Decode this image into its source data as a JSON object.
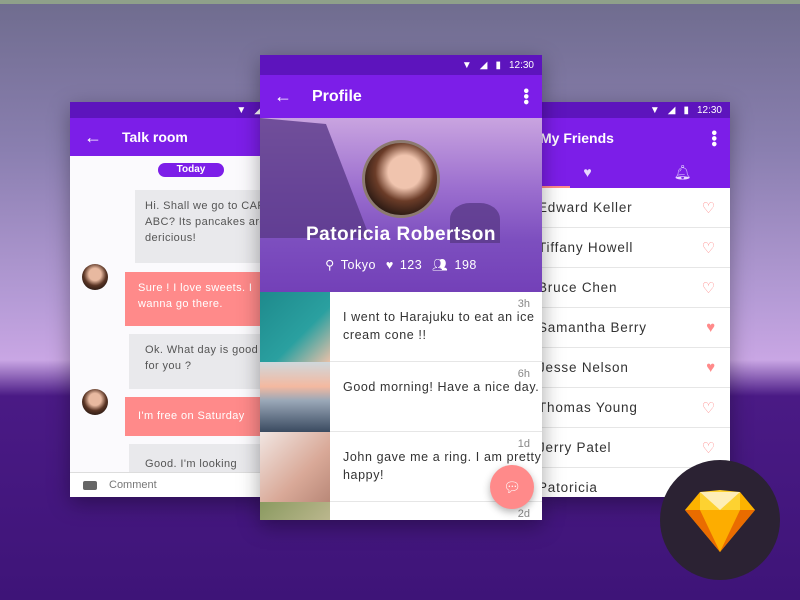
{
  "status": {
    "time": "12:30"
  },
  "talk": {
    "title": "Talk room",
    "date": "Today",
    "messages": [
      {
        "type": "in",
        "text": "Hi. Shall we go to CAFE ABC? Its pancakes are dericious!"
      },
      {
        "type": "out",
        "text": "Sure ! I love sweets. I wanna go there."
      },
      {
        "type": "in",
        "text": "Ok. What day is good for you ?"
      },
      {
        "type": "out",
        "text": "I'm free on Saturday"
      },
      {
        "type": "in",
        "text": "Good. I'm looking"
      }
    ],
    "comment_placeholder": "Comment"
  },
  "profile": {
    "title": "Profile",
    "name": "Patoricia Robertson",
    "location": "Tokyo",
    "likes": "123",
    "friends": "198",
    "posts": [
      {
        "text": "I went to Harajuku to eat an ice cream cone !!",
        "time": "3h"
      },
      {
        "text": "Good morning! Have a nice day.",
        "time": "6h"
      },
      {
        "text": "John gave me a ring. I am pretty happy!",
        "time": "1d"
      },
      {
        "text": "",
        "time": "2d"
      }
    ]
  },
  "friends": {
    "title": "My Friends",
    "tabs": [
      "heart-icon",
      "bell-icon"
    ],
    "list": [
      {
        "name": "Edward Keller",
        "fav": false
      },
      {
        "name": "Tiffany Howell",
        "fav": false
      },
      {
        "name": "Bruce Chen",
        "fav": false
      },
      {
        "name": "Samantha Berry",
        "fav": true
      },
      {
        "name": "Jesse Nelson",
        "fav": true
      },
      {
        "name": "Thomas Young",
        "fav": false
      },
      {
        "name": "Jerry Patel",
        "fav": false
      },
      {
        "name": "Patoricia",
        "fav": false
      }
    ]
  },
  "colors": {
    "primary": "#7c1ee8",
    "status": "#5d14bd",
    "accent": "#ff8a8a"
  }
}
